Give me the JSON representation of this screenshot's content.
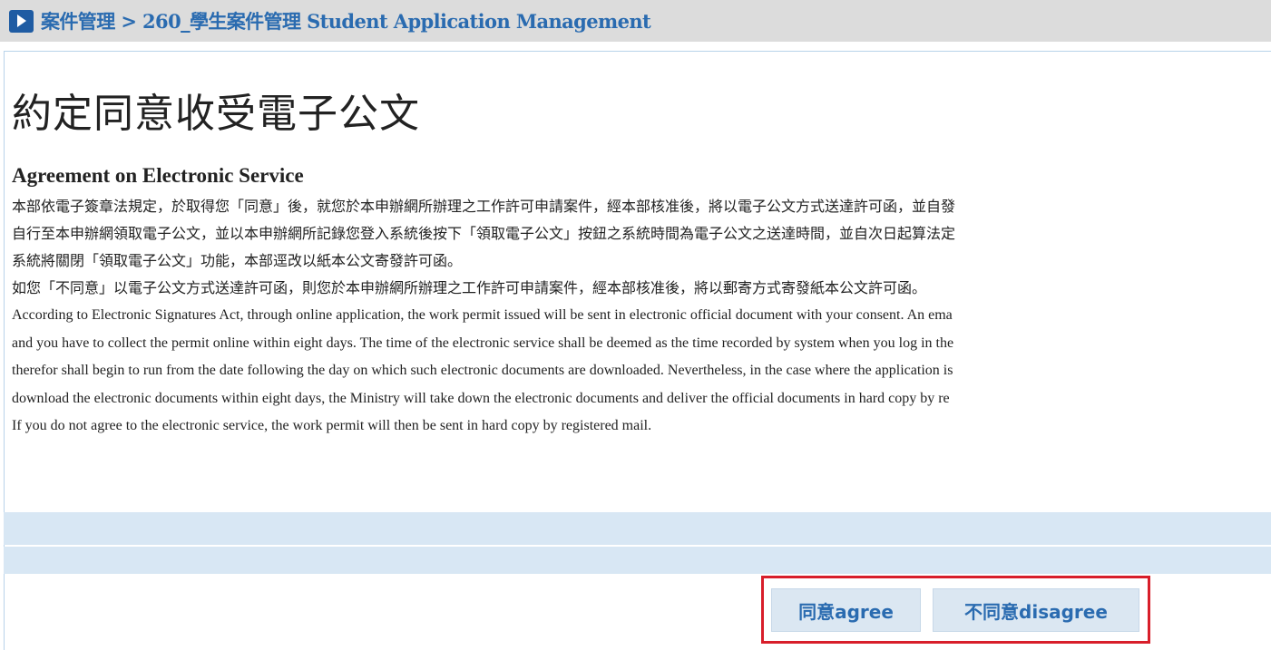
{
  "breadcrumb": {
    "section": "案件管理",
    "separator": ">",
    "page": "260_學生案件管理 Student Application Management"
  },
  "page_title": "約定同意收受電子公文",
  "subtitle": "Agreement on Electronic Service",
  "body": {
    "zh_lines": [
      "本部依電子簽章法規定，於取得您「同意」後，就您於本申辦網所辦理之工作許可申請案件，經本部核准後，將以電子公文方式送達許可函，並自發",
      "自行至本申辦網領取電子公文，並以本申辦網所記錄您登入系統後按下「領取電子公文」按鈕之系統時間為電子公文之送達時間，並自次日起算法定",
      "系統將關閉「領取電子公文」功能，本部逕改以紙本公文寄發許可函。",
      "如您「不同意」以電子公文方式送達許可函，則您於本申辦網所辦理之工作許可申請案件，經本部核准後，將以郵寄方式寄發紙本公文許可函。"
    ],
    "en_lines": [
      "According to Electronic Signatures Act, through online application, the work permit issued will be sent in electronic official document with your consent. An ema",
      "and you have to collect the permit online within eight days. The time of the electronic service shall be deemed as the time recorded by system when you log in the",
      "therefor shall begin to run from the date following the day on which such electronic documents are downloaded. Nevertheless, in the case where the application is",
      "download the electronic documents within eight days, the Ministry will take down the electronic documents and deliver the official documents in hard copy by re",
      "If you do not agree to the electronic service, the work permit will then be sent in hard copy by registered mail."
    ]
  },
  "buttons": {
    "agree": "同意agree",
    "disagree": "不同意disagree"
  },
  "colors": {
    "brand_blue": "#2a6bb0",
    "band_blue": "#d8e7f4",
    "highlight_red": "#d81e2a",
    "topbar_gray": "#dcdcdc"
  },
  "icons": {
    "breadcrumb_arrow": "chevron-right-icon"
  }
}
